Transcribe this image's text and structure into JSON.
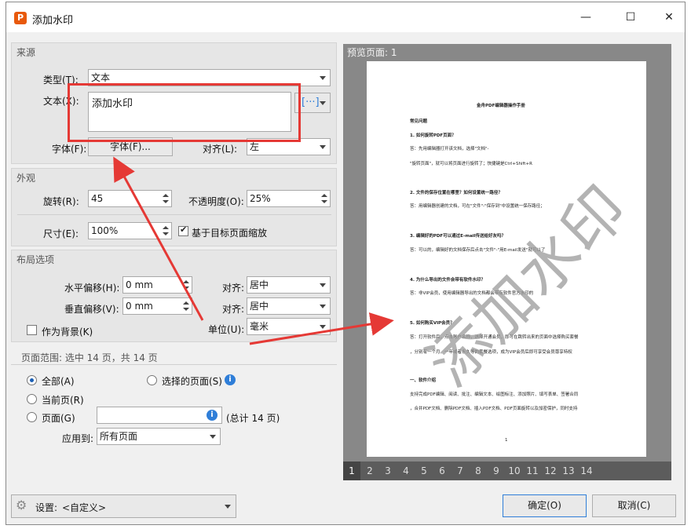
{
  "window": {
    "title": "添加水印",
    "minimize": "—",
    "maximize": "☐",
    "close": "✕",
    "app_icon": "P"
  },
  "source": {
    "group_title": "来源",
    "type_label": "类型(T):",
    "type_value": "文本",
    "text_label": "文本(X):",
    "text_value": "添加水印",
    "font_label": "字体(F):",
    "font_button": "字体(F)...",
    "align_label": "对齐(L):",
    "align_value": "左"
  },
  "appearance": {
    "group_title": "外观",
    "rotate_label": "旋转(R):",
    "rotate_value": "45",
    "opacity_label": "不透明度(O):",
    "opacity_value": "25%",
    "size_label": "尺寸(E):",
    "size_value": "100%",
    "scale_checkbox_label": "基于目标页面缩放",
    "scale_checked": true
  },
  "layout": {
    "group_title": "布局选项",
    "hoffset_label": "水平偏移(H):",
    "hoffset_value": "0 mm",
    "voffset_label": "垂直偏移(V):",
    "voffset_value": "0 mm",
    "halign_label": "对齐:",
    "halign_value": "居中",
    "valign_label": "对齐:",
    "valign_value": "居中",
    "background_label": "作为背景(K)",
    "background_checked": false,
    "unit_label": "单位(U):",
    "unit_value": "毫米"
  },
  "page_range": {
    "group_title": "页面范围: 选中 14 页，共 14 页",
    "all_label": "全部(A)",
    "selected_label": "选择的页面(S)",
    "current_label": "当前页(R)",
    "pages_label": "页面(G)",
    "pages_value": "",
    "total_label": "(总计 14 页)",
    "apply_label": "应用到:",
    "apply_value": "所有页面",
    "selected_option": "all"
  },
  "footer": {
    "settings_label": "设置:",
    "settings_value": "<自定义>",
    "ok": "确定(O)",
    "cancel": "取消(C)"
  },
  "preview": {
    "title": "预览页面: 1",
    "watermark": "添加水印",
    "page_number": "1",
    "pages": [
      "1",
      "2",
      "3",
      "4",
      "5",
      "6",
      "7",
      "8",
      "9",
      "10",
      "11",
      "12",
      "13",
      "14"
    ],
    "current_page": "1",
    "doc": {
      "title": "金舟PDF编辑器操作手册",
      "heading": "常见问题",
      "q1": "1. 如何旋转PDF页面？",
      "a1a": "答：先用编辑器打开该文档，选择\"文档\"-",
      "a1b": "\"旋转页面\"，就可以将页面进行旋转了；快捷键是Ctrl+Shift+R",
      "q2": "2. 文件的保存位置在哪里？如何设置统一路径？",
      "a2": "答：用编辑器创建的文档，可在\"文件\"-\"保存到\"中设置统一保存路径；",
      "q3": "3. 编辑好的PDF可以通过E-mail传送给好友吗？",
      "a3": "答：可以的，编辑好的文档保存后点击\"文件\"-\"用E-mail发送\"就可以了",
      "q4": "4. 为什么导出的文件会带有软件水印？",
      "a4": "答：非VIP会员，使用编辑器导出的文档都会带有软件官方水印的",
      "q5": "5. 如何购买VIP会员？",
      "a5a": "答：打开软件后，点击账户名称，选择开通会员，即可在跳转出来的页面中选择购买套餐",
      "a5b": "，分别有一个月、一年或者永久等的套餐选项，成为VIP会员后即可享受会员尊享特权",
      "sec": "一、软件介绍",
      "i1": "支持完成PDF编辑、阅读、批注、编辑文本、绘图标注、添加照片、填写表单、签署合同",
      "i2": "，合并PDF文档、删除PDF文档、插入PDF文档、PDF页面旋转以及加密保护，同时支持"
    }
  }
}
